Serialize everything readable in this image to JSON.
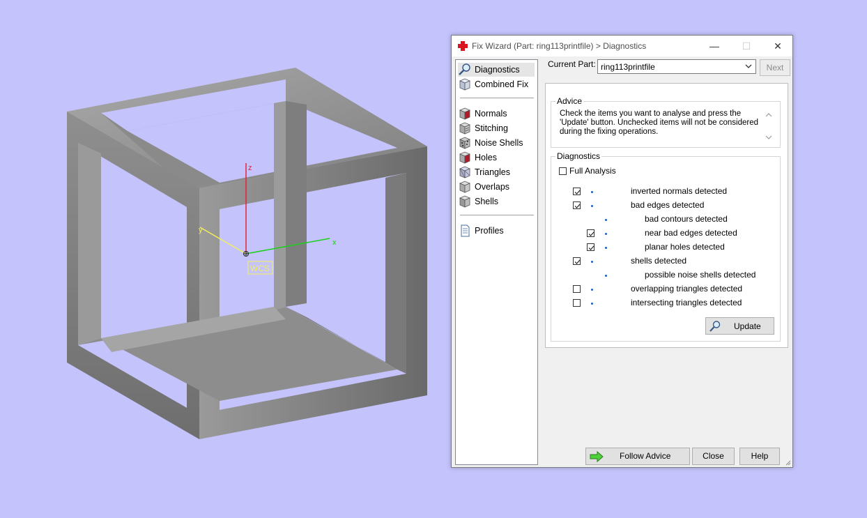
{
  "viewport": {
    "axis_labels": {
      "z": "z",
      "y": "y",
      "x": "x"
    },
    "wcs_label": "WCS",
    "colors": {
      "background": "#c4c3fb",
      "axis_z": "#e0243a",
      "axis_x": "#19d11a",
      "axis_y": "#f3ef5a",
      "model": "#8c8c8c"
    }
  },
  "dialog": {
    "title": "Fix Wizard (Part: ring113printfile) > Diagnostics",
    "title_icon": "red-cross-icon",
    "window_buttons": {
      "minimize": "—",
      "maximize": "☐",
      "close": "✕"
    }
  },
  "nav": {
    "items": [
      {
        "label": "Diagnostics",
        "icon": "magnifier-icon",
        "selected": true
      },
      {
        "label": "Combined Fix",
        "icon": "cube-icon"
      },
      {
        "label": "Normals",
        "icon": "normals-cube-icon"
      },
      {
        "label": "Stitching",
        "icon": "stitching-cube-icon"
      },
      {
        "label": "Noise Shells",
        "icon": "noise-shells-icon"
      },
      {
        "label": "Holes",
        "icon": "holes-cube-icon"
      },
      {
        "label": "Triangles",
        "icon": "triangles-cube-icon"
      },
      {
        "label": "Overlaps",
        "icon": "overlaps-cube-icon"
      },
      {
        "label": "Shells",
        "icon": "shells-cube-icon"
      },
      {
        "label": "Profiles",
        "icon": "profiles-document-icon"
      }
    ]
  },
  "current_part": {
    "label": "Current Part:",
    "value": "ring113printfile",
    "next_label": "Next"
  },
  "advice": {
    "title": "Advice",
    "text_lines": [
      "Check the items you want to analyse and press the",
      "'Update' button. Unchecked items will not be considered",
      "during the fixing operations."
    ]
  },
  "diagnostics": {
    "title": "Diagnostics",
    "full_analysis": {
      "label": "Full Analysis",
      "checked": false
    },
    "items": [
      {
        "label": "inverted normals detected",
        "checked": true,
        "level": 0
      },
      {
        "label": "bad edges detected",
        "checked": true,
        "level": 0
      },
      {
        "label": "bad contours detected",
        "checked": null,
        "level": 1
      },
      {
        "label": "near bad edges detected",
        "checked": true,
        "level": 1
      },
      {
        "label": "planar holes detected",
        "checked": true,
        "level": 1
      },
      {
        "label": "shells detected",
        "checked": true,
        "level": 0
      },
      {
        "label": "possible noise shells detected",
        "checked": null,
        "level": 1
      },
      {
        "label": "overlapping triangles detected",
        "checked": false,
        "level": 0
      },
      {
        "label": "intersecting triangles detected",
        "checked": false,
        "level": 0
      }
    ],
    "update_label": "Update"
  },
  "buttons": {
    "follow_advice": "Follow Advice",
    "close": "Close",
    "help": "Help"
  }
}
